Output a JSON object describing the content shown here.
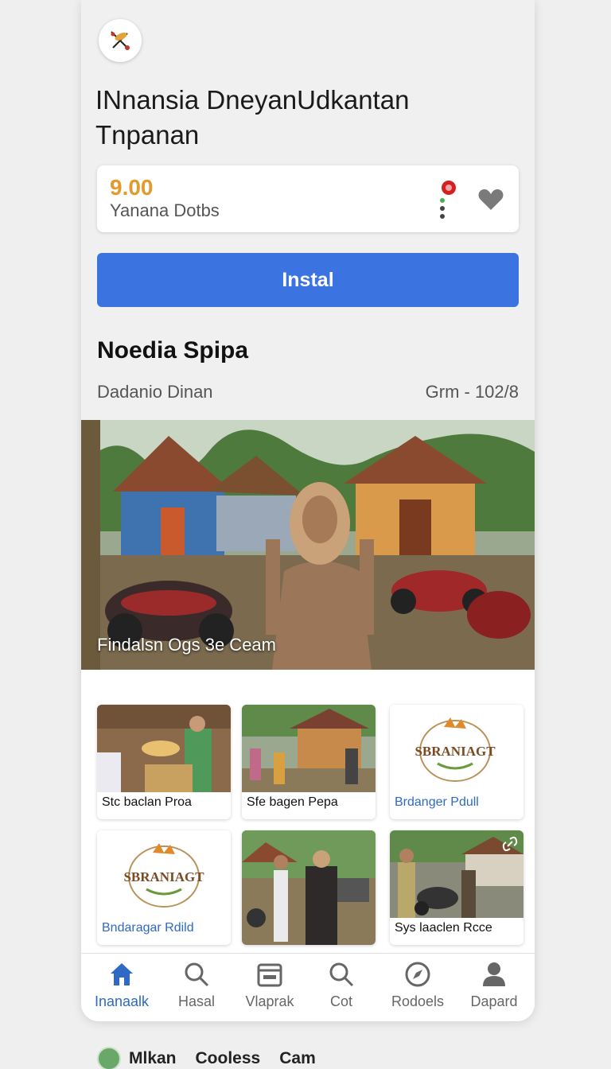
{
  "app": {
    "title": "INnansia DneyanUdkantan Tnpanan",
    "logo_icon": "kite-logo-icon"
  },
  "rating": {
    "score": "9.00",
    "subtitle": "Yanana Dotbs",
    "score_color": "#e39a2c"
  },
  "install_button": {
    "label": "Instal",
    "color": "#3b73e0"
  },
  "section": {
    "title": "Noedia Spipa",
    "left_meta": "Dadanio Dinan",
    "right_meta": "Grm - 102/8"
  },
  "hero": {
    "caption": "Findalsn Ogs 3e Ceam"
  },
  "tiles": [
    {
      "label": "Stc baclan Proa",
      "style": "photo"
    },
    {
      "label": "Sfe bagen Pepa",
      "style": "photo"
    },
    {
      "label": "Brdanger Pdull",
      "style": "logo",
      "logo_text": "SBRANIAGT"
    },
    {
      "label": "Bndaragar Rdild",
      "style": "logo",
      "logo_text": "SBRANIAGT"
    },
    {
      "label": "",
      "style": "photo"
    },
    {
      "label": "Sys laaclen Rcce",
      "style": "photo"
    }
  ],
  "nav": [
    {
      "label": "Inanaalk",
      "icon": "home-icon",
      "active": true
    },
    {
      "label": "Hasal",
      "icon": "search-icon",
      "active": false
    },
    {
      "label": "Vlaprak",
      "icon": "calendar-icon",
      "active": false
    },
    {
      "label": "Cot",
      "icon": "search-icon",
      "active": false
    },
    {
      "label": "Rodoels",
      "icon": "compass-icon",
      "active": false
    },
    {
      "label": "Dapard",
      "icon": "person-icon",
      "active": false
    }
  ],
  "bottom_bar": {
    "items": [
      "Mlkan",
      "Cooless",
      "Cam"
    ]
  },
  "colors": {
    "accent": "#2e69c6",
    "background": "#f0f0f0"
  }
}
